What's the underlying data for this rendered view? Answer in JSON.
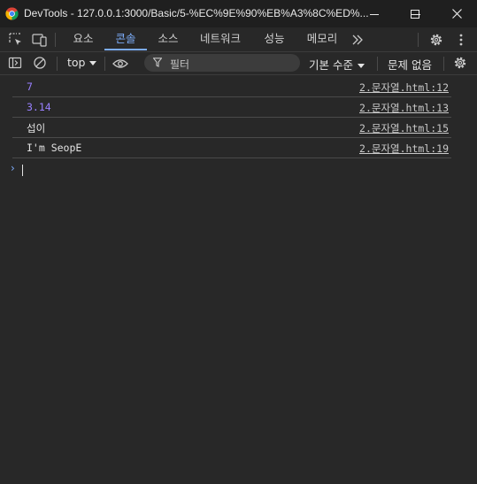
{
  "window": {
    "title": "DevTools - 127.0.0.1:3000/Basic/5-%EC%9E%90%EB%A3%8C%ED%..."
  },
  "tabs": [
    {
      "label": "요소"
    },
    {
      "label": "콘솔"
    },
    {
      "label": "소스"
    },
    {
      "label": "네트워크"
    },
    {
      "label": "성능"
    },
    {
      "label": "메모리"
    }
  ],
  "toolbar": {
    "context": "top",
    "filter_placeholder": "필터",
    "levels": "기본 수준",
    "issues": "문제 없음"
  },
  "console": {
    "messages": [
      {
        "text": "7",
        "kind": "number",
        "source": "2.문자열.html:12"
      },
      {
        "text": "3.14",
        "kind": "number",
        "source": "2.문자열.html:13"
      },
      {
        "text": "섭이",
        "kind": "string",
        "source": "2.문자열.html:15"
      },
      {
        "text": "I'm SeopE",
        "kind": "string",
        "source": "2.문자열.html:19"
      }
    ],
    "prompt": "›"
  },
  "colors": {
    "accent": "#7cacf8",
    "number": "#9980ff",
    "background": "#282828",
    "titlebar": "#1f1f1f"
  }
}
